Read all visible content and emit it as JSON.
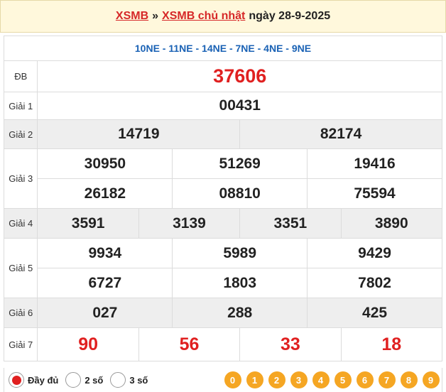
{
  "header": {
    "link1": "XSMB",
    "separator": "»",
    "link2": "XSMB chủ nhật",
    "date": "ngày 28-9-2025"
  },
  "codes": "10NE - 11NE - 14NE - 7NE - 4NE - 9NE",
  "prizes": {
    "db": {
      "label": "ĐB",
      "numbers": [
        "37606"
      ]
    },
    "g1": {
      "label": "Giải 1",
      "numbers": [
        "00431"
      ]
    },
    "g2": {
      "label": "Giải 2",
      "numbers": [
        "14719",
        "82174"
      ]
    },
    "g3": {
      "label": "Giải 3",
      "numbers": [
        "30950",
        "51269",
        "19416",
        "26182",
        "08810",
        "75594"
      ]
    },
    "g4": {
      "label": "Giải 4",
      "numbers": [
        "3591",
        "3139",
        "3351",
        "3890"
      ]
    },
    "g5": {
      "label": "Giải 5",
      "numbers": [
        "9934",
        "5989",
        "9429",
        "6727",
        "1803",
        "7802"
      ]
    },
    "g6": {
      "label": "Giải 6",
      "numbers": [
        "027",
        "288",
        "425"
      ]
    },
    "g7": {
      "label": "Giải 7",
      "numbers": [
        "90",
        "56",
        "33",
        "18"
      ]
    }
  },
  "footer": {
    "options": [
      "Đầy đủ",
      "2 số",
      "3 số"
    ],
    "selected": "Đầy đủ",
    "digits": [
      "0",
      "1",
      "2",
      "3",
      "4",
      "5",
      "6",
      "7",
      "8",
      "9"
    ]
  },
  "colors": {
    "accent_red": "#e02020",
    "code_blue": "#1a62b5",
    "digit_orange": "#f5a623",
    "header_bg": "#fff8dc"
  }
}
